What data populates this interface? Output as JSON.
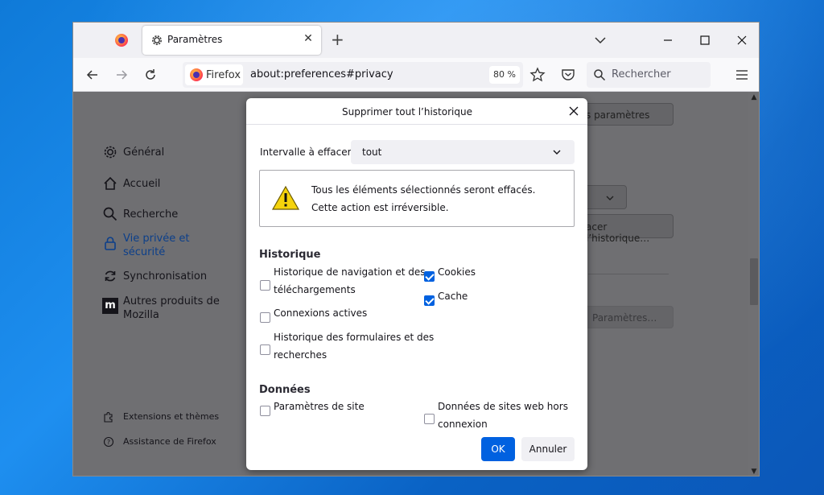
{
  "browser": {
    "tab": {
      "title": "Paramètres",
      "close": "✕"
    },
    "new_tab": "+",
    "identity_label": "Firefox",
    "url": "about:preferences#privacy",
    "zoom": "80 %",
    "search_placeholder": "Rechercher"
  },
  "sidebar": {
    "items": [
      {
        "label": "Général",
        "icon": "gear-icon"
      },
      {
        "label": "Accueil",
        "icon": "home-icon"
      },
      {
        "label": "Recherche",
        "icon": "search-icon"
      },
      {
        "label": "Vie privée et sécurité",
        "icon": "lock-icon",
        "active": true
      },
      {
        "label": "Synchronisation",
        "icon": "sync-icon"
      },
      {
        "label": "Autres produits de Mozilla",
        "icon": "mozilla-icon"
      }
    ],
    "footer": [
      {
        "label": "Extensions et thèmes",
        "icon": "puzzle-icon"
      },
      {
        "label": "Assistance de Firefox",
        "icon": "help-icon"
      }
    ]
  },
  "background_fields": {
    "find": "s paramètres",
    "clear_history": "acer l’historique…",
    "settings": "Paramètres…"
  },
  "dialog": {
    "title": "Supprimer tout l’historique",
    "range_label": "Intervalle à effacer :",
    "range_value": "tout",
    "warning_line1": "Tous les éléments sélectionnés seront effacés.",
    "warning_line2": "Cette action est irréversible.",
    "history_heading": "Historique",
    "history_items": [
      {
        "label_line1": "Historique de navigation et des",
        "label_line2": "téléchargements",
        "checked": false
      },
      {
        "label": "Connexions actives",
        "checked": false
      },
      {
        "label_line1": "Historique des formulaires et des",
        "label_line2": "recherches",
        "checked": false
      },
      {
        "label": "Cookies",
        "checked": true
      },
      {
        "label": "Cache",
        "checked": true
      }
    ],
    "data_heading": "Données",
    "data_items": [
      {
        "label": "Paramètres de site",
        "checked": false
      },
      {
        "label_line1": "Données de sites web hors",
        "label_line2": "connexion",
        "checked": false
      }
    ],
    "ok": "OK",
    "cancel": "Annuler"
  },
  "colors": {
    "accent": "#0061e0",
    "sidebar_active": "#0c3f8a",
    "overlay": "#6f6f72"
  }
}
